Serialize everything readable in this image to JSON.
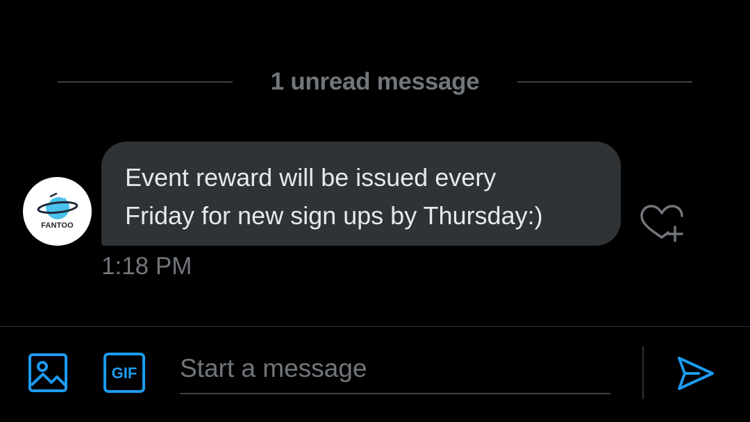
{
  "divider": {
    "label": "1 unread message"
  },
  "message": {
    "sender_avatar_text": "FANTOO",
    "text": "Event reward will be issued every\nFriday for new sign ups by Thursday:)",
    "time": "1:18 PM",
    "react_icon": "heart-plus-icon"
  },
  "composer": {
    "placeholder": "Start a message",
    "value": "",
    "media_icon": "image-icon",
    "gif_label": "GIF",
    "send_icon": "send-icon"
  },
  "colors": {
    "background": "#000000",
    "bubble": "#2f3336",
    "muted_text": "#71767b",
    "accent": "#1d9bf0",
    "text": "#e7e9ea"
  }
}
